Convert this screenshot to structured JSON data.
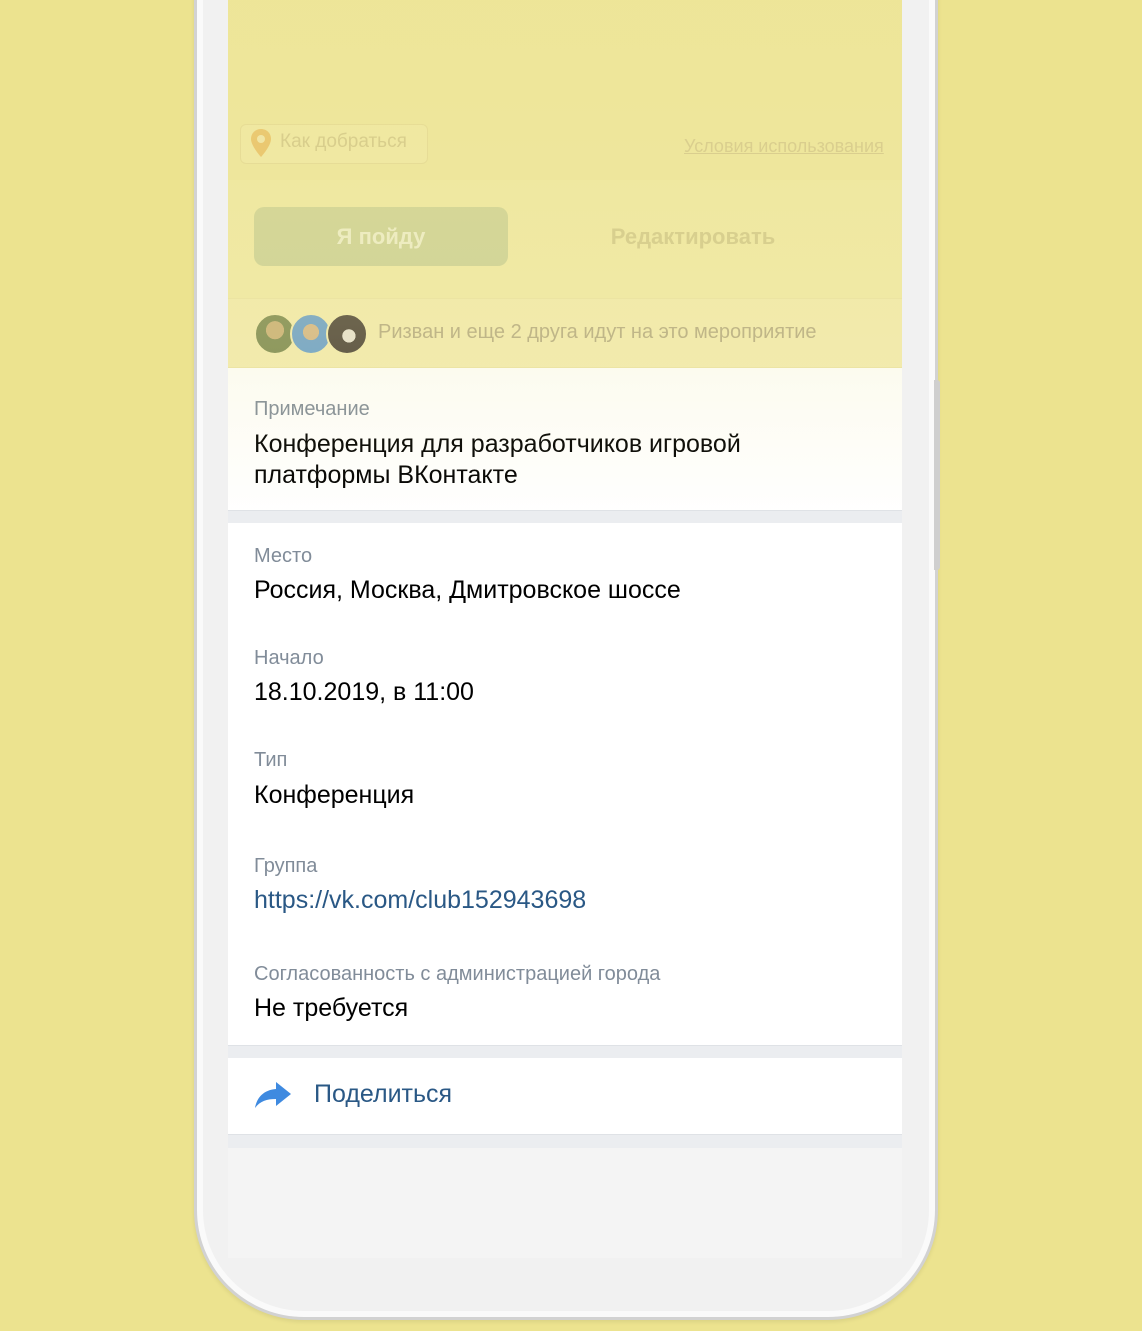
{
  "top": {
    "route_label": "Как добраться",
    "terms_label": "Условия использования"
  },
  "actions": {
    "go_label": "Я пойду",
    "edit_label": "Редактировать"
  },
  "friends": {
    "text": "Ризван и еще 2 друга идут на это мероприятие"
  },
  "note": {
    "label": "Примечание",
    "line1": "Конференция для разработчиков игровой",
    "line2": "платформы ВКонтакте"
  },
  "details": {
    "place_label": "Место",
    "place_value": "Россия, Москва, Дмитровское шоссе",
    "start_label": "Начало",
    "start_value": "18.10.2019, в 11:00",
    "type_label": "Тип",
    "type_value": "Конференция",
    "group_label": "Группа",
    "group_value": "https://vk.com/club152943698",
    "approval_label": "Согласованность с администрацией города",
    "approval_value": "Не требуется"
  },
  "share": {
    "label": "Поделиться",
    "icon": "share-arrow-icon"
  },
  "colors": {
    "background": "#ece38f",
    "link": "#2a5885",
    "label_gray": "#818c99",
    "share_icon": "#3f8ae0"
  }
}
